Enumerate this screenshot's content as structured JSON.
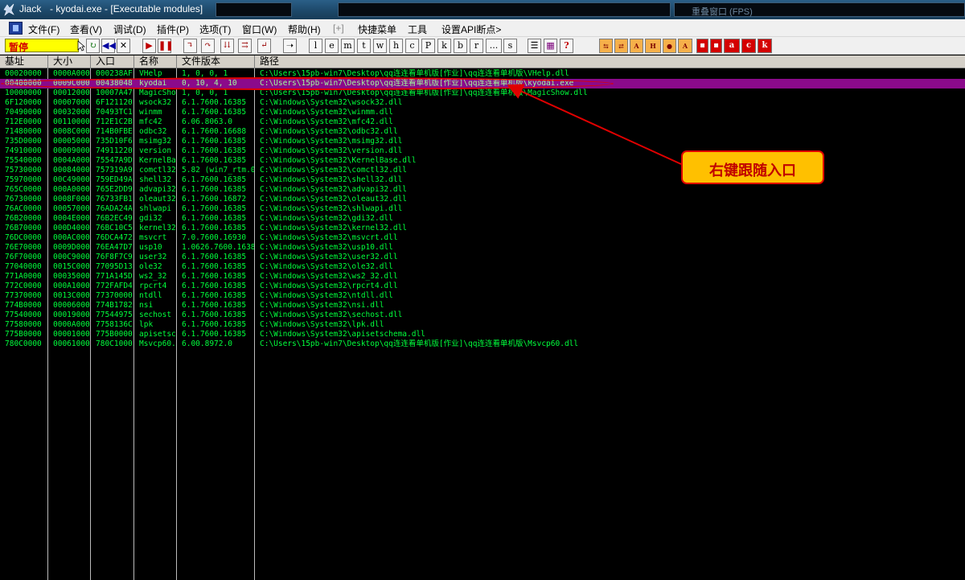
{
  "window": {
    "app_name": "Jiack",
    "title": "- kyodai.exe - [Executable modules]",
    "bg_title_fragment": "重叠窗口 (FPS)"
  },
  "menu": {
    "items": [
      {
        "label": "文件(F)"
      },
      {
        "label": "查看(V)"
      },
      {
        "label": "调试(D)"
      },
      {
        "label": "插件(P)"
      },
      {
        "label": "选项(T)"
      },
      {
        "label": "窗口(W)"
      },
      {
        "label": "帮助(H)"
      },
      {
        "label": "[+]"
      },
      {
        "label": "快捷菜单"
      },
      {
        "label": "工具"
      },
      {
        "label": "设置API断点>"
      }
    ]
  },
  "toolbar": {
    "status": "暂停",
    "letter_buttons": [
      "l",
      "e",
      "m",
      "t",
      "w",
      "h",
      "c",
      "P",
      "k",
      "b",
      "r",
      "...",
      "s"
    ]
  },
  "table": {
    "columns": [
      "基址",
      "大小",
      "入口",
      "名称",
      "文件版本",
      "路径"
    ],
    "selected_index": 1,
    "rows": [
      [
        "00020000",
        "0000A000",
        "000238AF",
        "VHelp",
        "1, 0, 0, 1",
        "C:\\Users\\15pb-win7\\Desktop\\qq连连看单机版[作业]\\qq连连看单机版\\VHelp.dll"
      ],
      [
        "00400000",
        "0009C000",
        "00438048",
        "kyodai",
        "0, 10, 4, 10",
        "C:\\Users\\15pb-win7\\Desktop\\qq连连看单机版[作业]\\qq连连看单机版\\kyodai.exe"
      ],
      [
        "10000000",
        "00012000",
        "10007A47",
        "MagicSho",
        "1, 0, 0, 1",
        "C:\\Users\\15pb-win7\\Desktop\\qq连连看单机版[作业]\\qq连连看单机版\\MagicShow.dll"
      ],
      [
        "6F120000",
        "00007000",
        "6F121120",
        "wsock32",
        "6.1.7600.16385",
        "C:\\Windows\\System32\\wsock32.dll"
      ],
      [
        "70490000",
        "00032000",
        "70493TC1",
        "winmm",
        "6.1.7600.16385",
        "C:\\Windows\\System32\\winmm.dll"
      ],
      [
        "712E0000",
        "00110000",
        "712E1C2B",
        "mfc42",
        "6.06.8063.0",
        "C:\\Windows\\System32\\mfc42.dll"
      ],
      [
        "71480000",
        "0008C000",
        "714B0FBE",
        "odbc32",
        "6.1.7600.16688",
        "C:\\Windows\\System32\\odbc32.dll"
      ],
      [
        "735D0000",
        "00005000",
        "735D10F6",
        "msimg32",
        "6.1.7600.16385",
        "C:\\Windows\\System32\\msimg32.dll"
      ],
      [
        "74910000",
        "00009000",
        "74911220",
        "version",
        "6.1.7600.16385",
        "C:\\Windows\\System32\\version.dll"
      ],
      [
        "75540000",
        "0004A000",
        "75547A9D",
        "KernelBa",
        "6.1.7600.16385",
        "C:\\Windows\\System32\\KernelBase.dll"
      ],
      [
        "75730000",
        "00084000",
        "757319A9",
        "comctl32",
        "5.82 (win7_rtm.0",
        "C:\\Windows\\System32\\comctl32.dll"
      ],
      [
        "75970000",
        "00C49000",
        "759ED49A",
        "shell32",
        "6.1.7600.16385",
        "C:\\Windows\\System32\\shell32.dll"
      ],
      [
        "765C0000",
        "000A0000",
        "765E2DD9",
        "advapi32",
        "6.1.7600.16385",
        "C:\\Windows\\System32\\advapi32.dll"
      ],
      [
        "76730000",
        "0008F000",
        "76733FB1",
        "oleaut32",
        "6.1.7600.16872",
        "C:\\Windows\\System32\\oleaut32.dll"
      ],
      [
        "76AC0000",
        "00057000",
        "76ADA24A",
        "shlwapi",
        "6.1.7600.16385",
        "C:\\Windows\\System32\\shlwapi.dll"
      ],
      [
        "76B20000",
        "0004E000",
        "76B2EC49",
        "gdi32",
        "6.1.7600.16385",
        "C:\\Windows\\System32\\gdi32.dll"
      ],
      [
        "76B70000",
        "000D4000",
        "76BC10C5",
        "kernel32",
        "6.1.7600.16385",
        "C:\\Windows\\System32\\kernel32.dll"
      ],
      [
        "76DC0000",
        "000AC000",
        "76DCA472",
        "msvcrt",
        "7.0.7600.16930",
        "C:\\Windows\\System32\\msvcrt.dll"
      ],
      [
        "76E70000",
        "0009D000",
        "76EA47D7",
        "usp10",
        "1.0626.7600.1638",
        "C:\\Windows\\System32\\usp10.dll"
      ],
      [
        "76F70000",
        "000C9000",
        "76F8F7C9",
        "user32",
        "6.1.7600.16385",
        "C:\\Windows\\System32\\user32.dll"
      ],
      [
        "77040000",
        "0015C000",
        "77095D13",
        "ole32",
        "6.1.7600.16385",
        "C:\\Windows\\System32\\ole32.dll"
      ],
      [
        "771A0000",
        "00035000",
        "771A145D",
        "ws2_32",
        "6.1.7600.16385",
        "C:\\Windows\\System32\\ws2_32.dll"
      ],
      [
        "772C0000",
        "000A1000",
        "772FAFD4",
        "rpcrt4",
        "6.1.7600.16385",
        "C:\\Windows\\System32\\rpcrt4.dll"
      ],
      [
        "77370000",
        "0013C000",
        "77370000",
        "ntdll",
        "6.1.7600.16385",
        "C:\\Windows\\System32\\ntdll.dll"
      ],
      [
        "774B0000",
        "00006000",
        "774B1782",
        "nsi",
        "6.1.7600.16385",
        "C:\\Windows\\System32\\nsi.dll"
      ],
      [
        "77540000",
        "00019000",
        "77544975",
        "sechost",
        "6.1.7600.16385",
        "C:\\Windows\\System32\\sechost.dll"
      ],
      [
        "77580000",
        "0000A000",
        "7758136C",
        "lpk",
        "6.1.7600.16385",
        "C:\\Windows\\System32\\lpk.dll"
      ],
      [
        "775B0000",
        "00001000",
        "775B0000",
        "apisetsc",
        "6.1.7600.16385",
        "C:\\Windows\\System32\\apisetschema.dll"
      ],
      [
        "780C0000",
        "00061000",
        "780C1000",
        "Msvcp60.",
        "6.00.8972.0",
        "C:\\Users\\15pb-win7\\Desktop\\qq连连看单机版[作业]\\qq连连看单机版\\Msvcp60.dll"
      ]
    ]
  },
  "annotation": {
    "text": "右键跟随入口",
    "color": "#e00000",
    "box_color": "#ffc000"
  },
  "colors": {
    "text_green": "#00ff3c",
    "selected_row": "#8b0a8b",
    "status_bg": "#ffff00",
    "status_text": "#d40000"
  }
}
